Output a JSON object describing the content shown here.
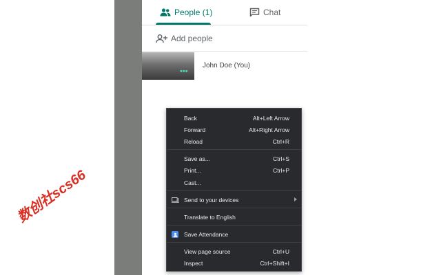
{
  "tabs": {
    "people_label": "People (1)",
    "chat_label": "Chat",
    "people_icon": "people-icon",
    "chat_icon": "chat-icon"
  },
  "add_people": {
    "label": "Add people",
    "icon": "add-person-icon"
  },
  "participant": {
    "name": "John Doe (You)",
    "more_icon": "more-dots-icon"
  },
  "watermark": {
    "text": "数创社scs66"
  },
  "context_menu": {
    "items": [
      {
        "label": "Back",
        "shortcut": "Alt+Left Arrow"
      },
      {
        "label": "Forward",
        "shortcut": "Alt+Right Arrow"
      },
      {
        "label": "Reload",
        "shortcut": "Ctrl+R"
      },
      {
        "label": "Save as...",
        "shortcut": "Ctrl+S"
      },
      {
        "label": "Print...",
        "shortcut": "Ctrl+P"
      },
      {
        "label": "Cast...",
        "shortcut": ""
      },
      {
        "label": "Send to your devices",
        "shortcut": "",
        "icon": "device-icon",
        "submenu": true
      },
      {
        "label": "Translate to English",
        "shortcut": ""
      },
      {
        "label": "Save Attendance",
        "shortcut": "",
        "icon": "extension-icon"
      },
      {
        "label": "View page source",
        "shortcut": "Ctrl+U"
      },
      {
        "label": "Inspect",
        "shortcut": "Ctrl+Shift+I"
      }
    ]
  },
  "colors": {
    "accent": "#00796b",
    "menu_bg": "#292a2d",
    "menu_text": "#e8eaed",
    "watermark": "#d93025"
  }
}
